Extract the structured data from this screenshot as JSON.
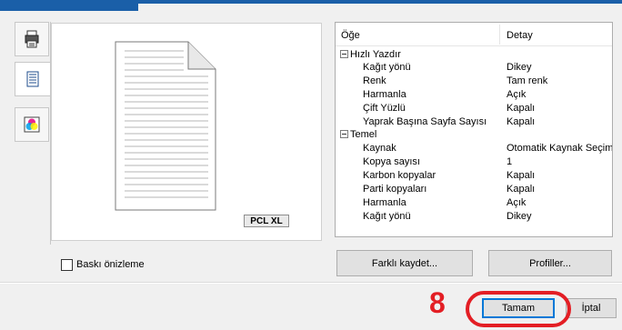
{
  "tabs": [
    {
      "icon": "printer-icon"
    },
    {
      "icon": "document-icon"
    },
    {
      "icon": "color-icon"
    }
  ],
  "preview": {
    "badge": "PCL XL",
    "checkbox_label": "Baskı önizleme",
    "checked": false
  },
  "table": {
    "col_item": "Öğe",
    "col_detail": "Detay",
    "groups": [
      {
        "name": "Hızlı Yazdır",
        "rows": [
          {
            "k": "Kağıt yönü",
            "v": "Dikey"
          },
          {
            "k": "Renk",
            "v": "Tam renk"
          },
          {
            "k": "Harmanla",
            "v": "Açık"
          },
          {
            "k": "Çift Yüzlü",
            "v": "Kapalı"
          },
          {
            "k": "Yaprak Başına Sayfa Sayısı",
            "v": "Kapalı"
          }
        ]
      },
      {
        "name": "Temel",
        "rows": [
          {
            "k": "Kaynak",
            "v": "Otomatik Kaynak Seçimi"
          },
          {
            "k": "Kopya sayısı",
            "v": "1"
          },
          {
            "k": "Karbon kopyalar",
            "v": "Kapalı"
          },
          {
            "k": "Parti kopyaları",
            "v": "Kapalı"
          },
          {
            "k": "Harmanla",
            "v": "Açık"
          },
          {
            "k": "Kağıt yönü",
            "v": "Dikey"
          }
        ]
      }
    ]
  },
  "buttons": {
    "save_as": "Farklı kaydet...",
    "profiles": "Profiller...",
    "ok": "Tamam",
    "cancel": "İptal"
  },
  "annotation": {
    "step": "8",
    "color": "#e31e24"
  },
  "colors": {
    "accent": "#1a5fa8",
    "focus": "#0078d7"
  }
}
